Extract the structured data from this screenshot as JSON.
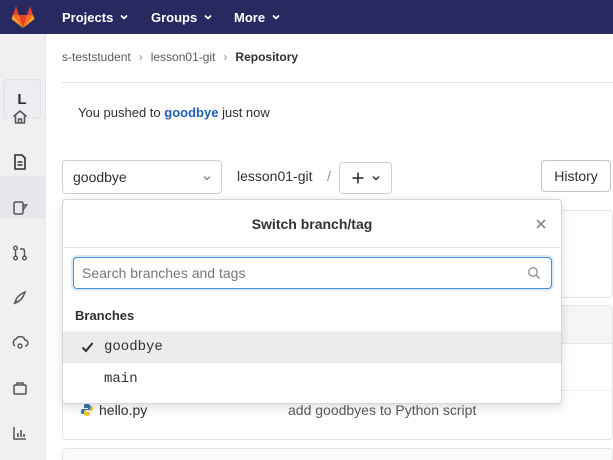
{
  "nav": {
    "logo_icon": "gitlab-tanuki-icon",
    "items": [
      {
        "label": "Projects"
      },
      {
        "label": "Groups"
      },
      {
        "label": "More"
      }
    ],
    "bg_color": "#292961"
  },
  "sidebar": {
    "project_initial": "L",
    "icons": [
      "home-icon",
      "document-icon",
      "issues-icon",
      "merge-request-icon",
      "rocket-icon",
      "operations-icon",
      "package-icon",
      "analytics-icon"
    ]
  },
  "breadcrumb": {
    "items": [
      "s-teststudent",
      "lesson01-git",
      "Repository"
    ]
  },
  "flash": {
    "prefix": "You pushed to",
    "branch": "goodbye",
    "suffix": "just now"
  },
  "controls": {
    "current_branch": "goodbye",
    "path": "lesson01-git",
    "path_separator": "/",
    "history_label": "History"
  },
  "files": [
    {
      "name": "hello.py",
      "icon": "python-icon",
      "commit_message": "add goodbyes to Python script"
    }
  ],
  "dropdown": {
    "title": "Switch branch/tag",
    "search_placeholder": "Search branches and tags",
    "section_label": "Branches",
    "branches": [
      {
        "name": "goodbye",
        "selected": true
      },
      {
        "name": "main",
        "selected": false
      }
    ]
  }
}
